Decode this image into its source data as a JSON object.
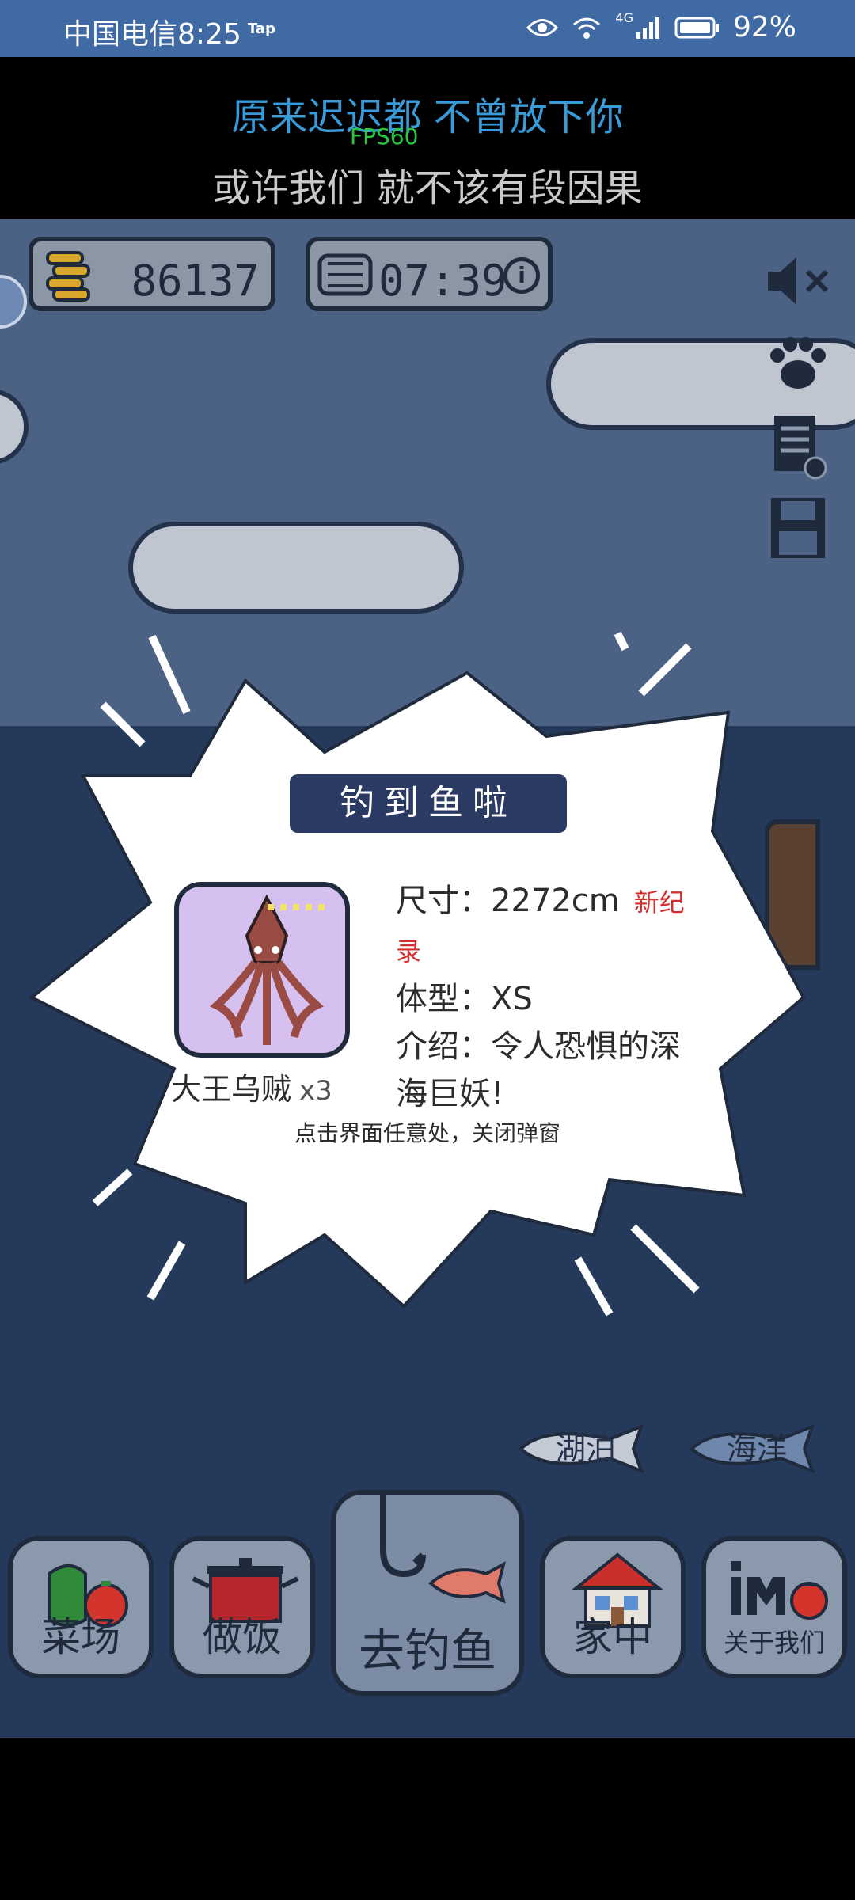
{
  "status_bar": {
    "carrier_time": "中国电信8:25",
    "tap_indicator": "Tap",
    "network": "4G",
    "battery_percent": "92%",
    "icons": [
      "eye-icon",
      "wifi-icon",
      "signal-icon",
      "battery-icon"
    ]
  },
  "lyrics": {
    "line1": "原来迟迟都 不曾放下你",
    "fps": "FPS60",
    "line2": "或许我们 就不该有段因果"
  },
  "hud": {
    "coins": "86137",
    "timer": "07:39",
    "timer_info_glyph": "i"
  },
  "side_menu": {
    "icons": [
      "mute-icon",
      "paw-icon",
      "log-icon",
      "save-icon"
    ]
  },
  "popup": {
    "title": "钓到鱼啦",
    "fish_name": "大王乌贼",
    "fish_count": "x3",
    "size_label": "尺寸：",
    "size_value": "2272cm",
    "new_record": "新纪",
    "new_record_cont": "录",
    "body_label": "体型：",
    "body_value": "XS",
    "intro_label": "介绍：",
    "intro_value": "令人恐惧的深",
    "intro_value_cont": "海巨妖!",
    "close_hint": "点击界面任意处，关闭弹窗"
  },
  "water_tabs": {
    "lake": "湖泊",
    "ocean": "海洋"
  },
  "nav": {
    "farm": "菜场",
    "cook": "做饭",
    "fish": "去钓鱼",
    "home": "家中",
    "about": "关于我们"
  },
  "colors": {
    "status_bar": "#3f6aa3",
    "sky": "#4c6284",
    "sea": "#253a5b",
    "lyric_highlight": "#3a9bd9",
    "fps": "#27c93f",
    "new_record": "#d32f2f",
    "popup_title_bg": "#2b3a62",
    "fish_card_bg": "#d6c0ef"
  }
}
